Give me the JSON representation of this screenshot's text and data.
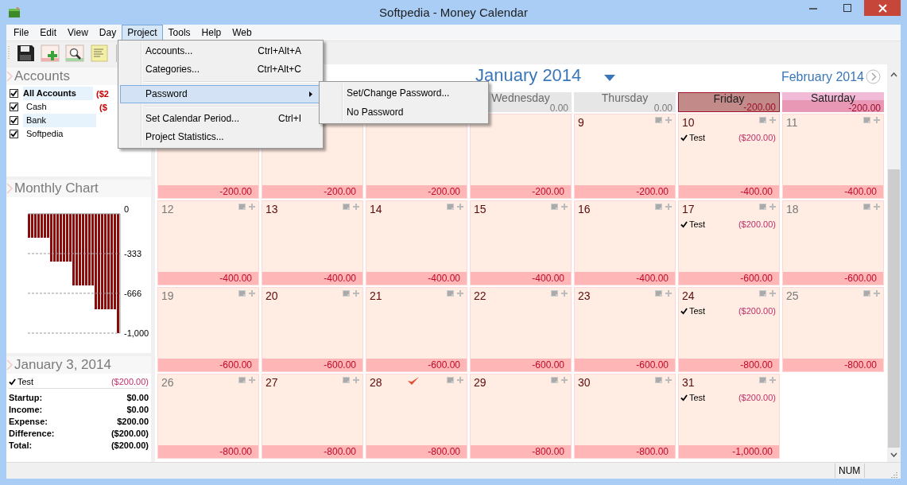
{
  "window": {
    "title": "Softpedia - Money Calendar"
  },
  "menu_bar": [
    {
      "label": "File",
      "selected": false
    },
    {
      "label": "Edit",
      "selected": false
    },
    {
      "label": "View",
      "selected": false
    },
    {
      "label": "Day",
      "selected": false
    },
    {
      "label": "Project",
      "selected": true
    },
    {
      "label": "Tools",
      "selected": false
    },
    {
      "label": "Help",
      "selected": false
    },
    {
      "label": "Web",
      "selected": false
    }
  ],
  "project_menu": {
    "items": [
      {
        "kind": "item",
        "label": "Accounts...",
        "shortcut": "Ctrl+Alt+A",
        "selected": false
      },
      {
        "kind": "item",
        "label": "Categories...",
        "shortcut": "Ctrl+Alt+C",
        "selected": false
      },
      {
        "kind": "separator"
      },
      {
        "kind": "submenu",
        "label": "Password",
        "selected": true
      },
      {
        "kind": "separator"
      },
      {
        "kind": "item",
        "label": "Set Calendar Period...",
        "shortcut": "Ctrl+I",
        "selected": false
      },
      {
        "kind": "item",
        "label": "Project Statistics...",
        "selected": false
      }
    ]
  },
  "password_submenu": {
    "items": [
      {
        "label": "Set/Change Password...",
        "selected": false
      },
      {
        "label": "No Password",
        "selected": false
      }
    ]
  },
  "accounts": {
    "title": "Accounts",
    "items": [
      {
        "kind": "total",
        "name": "All Accounts",
        "amount": "($2",
        "checked": true
      },
      {
        "kind": "account",
        "name": "Cash",
        "amount": "($",
        "checked": true
      },
      {
        "kind": "account",
        "name": "Bank",
        "checked": true
      },
      {
        "kind": "account",
        "name": "Softpedia",
        "checked": true
      }
    ]
  },
  "monthly_chart": {
    "title": "Monthly Chart",
    "chart_data": {
      "type": "bar",
      "series": [
        {
          "color": "#8b0a0a",
          "values": [
            -200,
            -200,
            -200,
            -200,
            -200,
            -200,
            -200,
            -400,
            -400,
            -400,
            -400,
            -400,
            -400,
            -400,
            -600,
            -600,
            -600,
            -600,
            -600,
            -600,
            -600,
            -800,
            -800,
            -800,
            -800,
            -800,
            -800,
            -800,
            -1000
          ]
        }
      ],
      "ylim": [
        -1000,
        0
      ],
      "yticks": [
        {
          "value": 0,
          "label": "0"
        },
        {
          "value": -333,
          "label": "-333"
        },
        {
          "value": -666,
          "label": "-666"
        },
        {
          "value": -1000,
          "label": "-1,000"
        }
      ]
    }
  },
  "day_details": {
    "title": "January 3, 2014",
    "entries": [
      {
        "name": "Test",
        "amount": "($200.00)",
        "done": true
      }
    ],
    "summary": [
      {
        "label": "Startup:",
        "value": "$0.00"
      },
      {
        "label": "Income:",
        "value": "$0.00"
      },
      {
        "label": "Expense:",
        "value": "$200.00"
      },
      {
        "label": "Difference:",
        "value": "($200.00)"
      },
      {
        "label": "Total:",
        "value": "($200.00)"
      }
    ]
  },
  "calendar": {
    "month": "January 2014",
    "next_month": "February 2014",
    "weekdays": [
      {
        "name": "Wednesday",
        "amount": "0.00",
        "kind": "normal"
      },
      {
        "name": "Thursday",
        "amount": "0.00",
        "kind": "normal"
      },
      {
        "name": "Friday",
        "amount": "-200.00",
        "kind": "selected"
      },
      {
        "name": "Saturday",
        "amount": "-200.00",
        "kind": "weekend"
      }
    ],
    "weeks": [
      {
        "days": [
          {
            "balance": "-200.00"
          },
          {
            "balance": "-200.00"
          },
          {
            "balance": "-200.00"
          },
          {
            "balance": "-200.00"
          },
          {
            "date": "9",
            "balance": "-200.00",
            "weekend": false,
            "marked": false
          },
          {
            "date": "10",
            "balance": "-400.00",
            "weekend": false,
            "marked": false,
            "entries": [
              {
                "name": "Test",
                "amount": "($200.00)",
                "done": true
              }
            ]
          },
          {
            "date": "11",
            "balance": "-400.00",
            "weekend": true,
            "marked": false
          }
        ]
      },
      {
        "days": [
          {
            "date": "12",
            "balance": "-400.00",
            "weekend": true,
            "marked": false
          },
          {
            "date": "13",
            "balance": "-400.00",
            "weekend": false,
            "marked": false
          },
          {
            "date": "14",
            "balance": "-400.00",
            "weekend": false,
            "marked": false
          },
          {
            "date": "15",
            "balance": "-400.00",
            "weekend": false,
            "marked": false
          },
          {
            "date": "16",
            "balance": "-400.00",
            "weekend": false,
            "marked": false
          },
          {
            "date": "17",
            "balance": "-600.00",
            "weekend": false,
            "marked": false,
            "entries": [
              {
                "name": "Test",
                "amount": "($200.00)",
                "done": true
              }
            ]
          },
          {
            "date": "18",
            "balance": "-600.00",
            "weekend": true,
            "marked": false
          }
        ]
      },
      {
        "days": [
          {
            "date": "19",
            "balance": "-600.00",
            "weekend": true,
            "marked": false
          },
          {
            "date": "20",
            "balance": "-600.00",
            "weekend": false,
            "marked": false
          },
          {
            "date": "21",
            "balance": "-600.00",
            "weekend": false,
            "marked": false
          },
          {
            "date": "22",
            "balance": "-600.00",
            "weekend": false,
            "marked": false
          },
          {
            "date": "23",
            "balance": "-600.00",
            "weekend": false,
            "marked": false
          },
          {
            "date": "24",
            "balance": "-800.00",
            "weekend": false,
            "marked": false,
            "entries": [
              {
                "name": "Test",
                "amount": "($200.00)",
                "done": true
              }
            ]
          },
          {
            "date": "25",
            "balance": "-800.00",
            "weekend": true,
            "marked": false
          }
        ]
      },
      {
        "days": [
          {
            "date": "26",
            "balance": "-800.00",
            "weekend": true,
            "marked": false
          },
          {
            "date": "27",
            "balance": "-800.00",
            "weekend": false,
            "marked": false
          },
          {
            "date": "28",
            "balance": "-800.00",
            "weekend": false,
            "marked": true
          },
          {
            "date": "29",
            "balance": "-800.00",
            "weekend": false,
            "marked": false
          },
          {
            "date": "30",
            "balance": "-800.00",
            "weekend": false,
            "marked": false
          },
          {
            "date": "31",
            "balance": "-1,000.00",
            "weekend": false,
            "marked": false,
            "entries": [
              {
                "name": "Test",
                "amount": "($200.00)",
                "done": true
              }
            ]
          }
        ]
      }
    ]
  },
  "status_bar": {
    "indicator": "NUM"
  }
}
